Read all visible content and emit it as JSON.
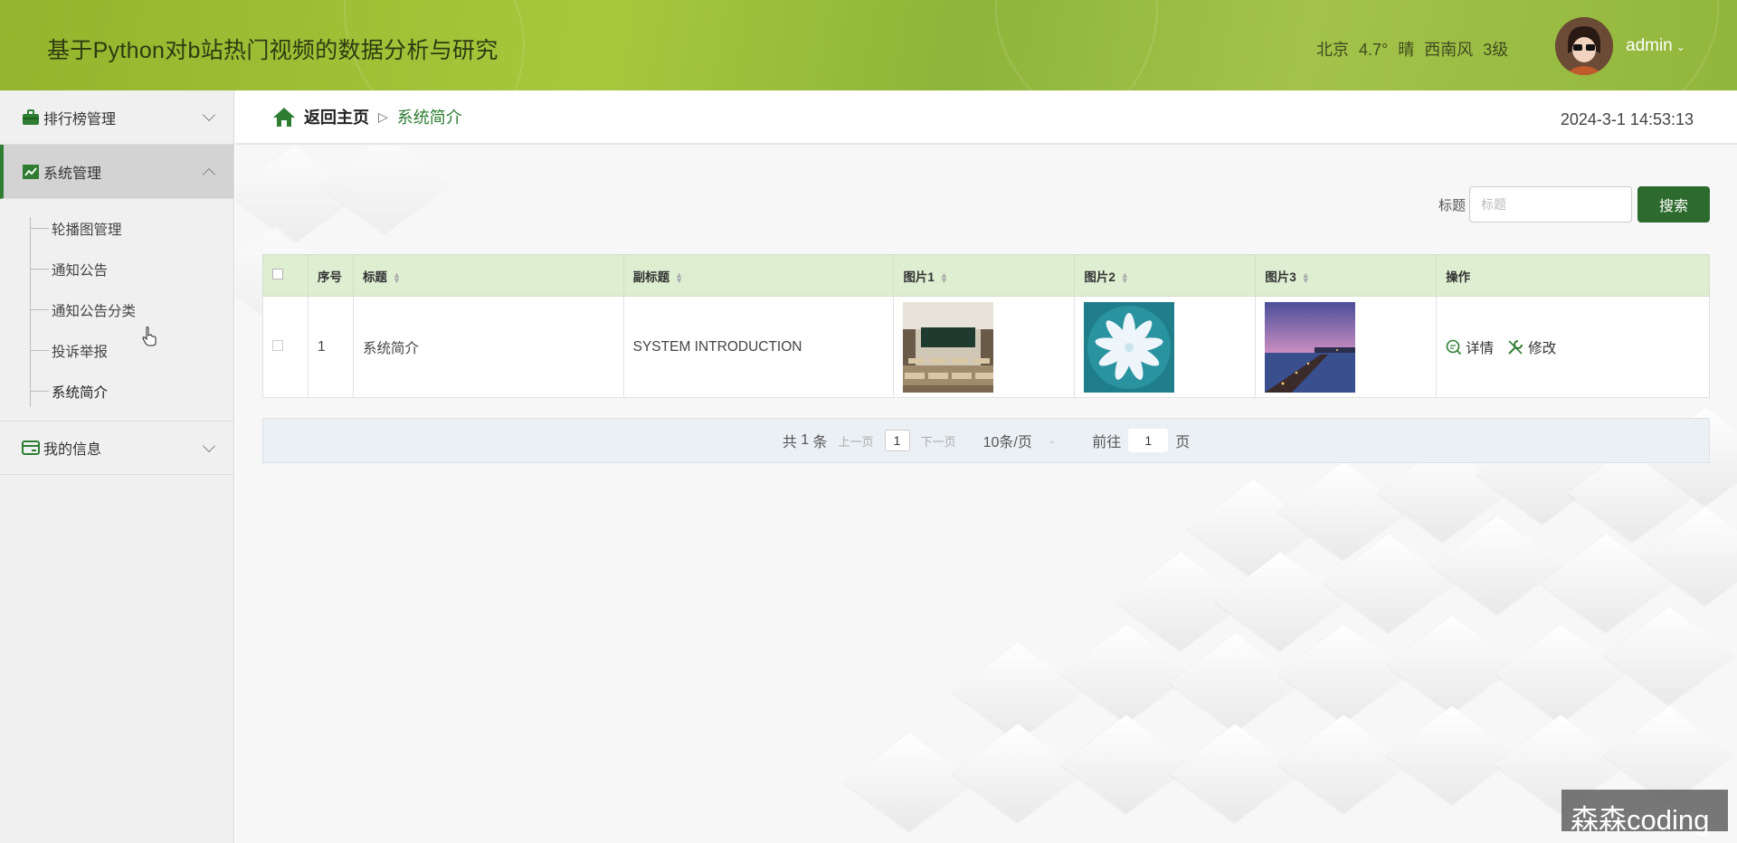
{
  "header": {
    "title": "基于Python对b站热门视频的数据分析与研究",
    "weather": {
      "city": "北京",
      "temp": "4.7°",
      "condition": "晴",
      "wind": "西南风",
      "level": "3级"
    },
    "username": "admin",
    "caret": "⌄"
  },
  "sidebar": {
    "menus": [
      {
        "label": "排行榜管理",
        "icon": "briefcase-icon"
      },
      {
        "label": "系统管理",
        "icon": "chart-icon"
      },
      {
        "label": "我的信息",
        "icon": "card-icon"
      }
    ],
    "submenu": [
      "轮播图管理",
      "通知公告",
      "通知公告分类",
      "投诉举报",
      "系统简介"
    ]
  },
  "breadcrumb": {
    "home": "返回主页",
    "separator": "▷",
    "current": "系统简介"
  },
  "clock": "2024-3-1 14:53:13",
  "search": {
    "label": "标题",
    "placeholder": "标题",
    "button": "搜索"
  },
  "table": {
    "headers": [
      "序号",
      "标题",
      "副标题",
      "图片1",
      "图片2",
      "图片3",
      "操作"
    ],
    "rows": [
      {
        "index": "1",
        "title": "系统简介",
        "subtitle": "SYSTEM INTRODUCTION",
        "detail": "详情",
        "edit": "修改"
      }
    ]
  },
  "pager": {
    "total_prefix": "共",
    "total": "1",
    "total_suffix": "条",
    "prev": "上一页",
    "page": "1",
    "next": "下一页",
    "page_size": "10条/页",
    "goto_prefix": "前往",
    "goto_page": "1",
    "goto_suffix": "页"
  },
  "watermark": "森森coding",
  "colors": {
    "header_green": "#9bbf3a",
    "accent_green": "#2d6a2d",
    "table_header": "#ddeed1"
  }
}
